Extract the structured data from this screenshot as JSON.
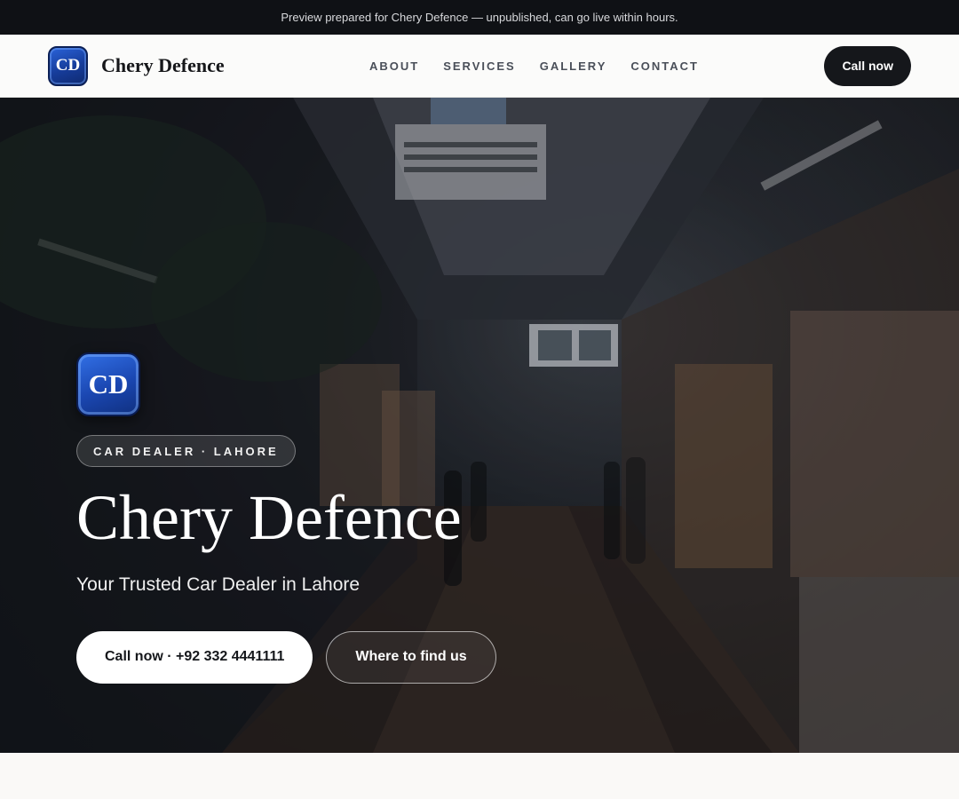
{
  "preview_bar": {
    "text": "Preview prepared for Chery Defence — unpublished, can go live within hours."
  },
  "nav": {
    "logo_initials": "CD",
    "brand_name": "Chery Defence",
    "links": [
      {
        "label": "ABOUT"
      },
      {
        "label": "SERVICES"
      },
      {
        "label": "GALLERY"
      },
      {
        "label": "CONTACT"
      }
    ],
    "cta_label": "Call now"
  },
  "hero": {
    "logo_initials": "CD",
    "badge": "CAR DEALER · LAHORE",
    "title": "Chery Defence",
    "subtitle": "Your Trusted Car Dealer in Lahore",
    "primary_button": "Call now · +92 332 4441111",
    "secondary_button": "Where to find us"
  },
  "colors": {
    "dark": "#15171b",
    "logo_blue": "#1a46b0",
    "background": "#faf9f7"
  }
}
